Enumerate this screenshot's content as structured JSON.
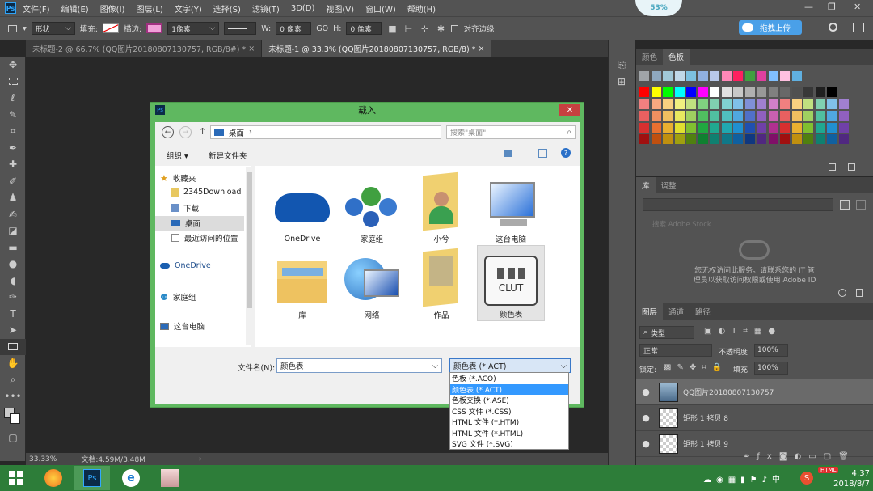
{
  "menubar": {
    "items": [
      "文件(F)",
      "编辑(E)",
      "图像(I)",
      "图层(L)",
      "文字(Y)",
      "选择(S)",
      "滤镜(T)",
      "3D(D)",
      "视图(V)",
      "窗口(W)",
      "帮助(H)"
    ],
    "badge": "53%",
    "window_controls": [
      "—",
      "❐",
      "✕"
    ]
  },
  "options": {
    "shape": "形状",
    "fill_label": "填充:",
    "stroke_label": "描边:",
    "stroke_width": "1像素",
    "w_label": "W:",
    "w_value": "0 像素",
    "link": "GO",
    "h_label": "H:",
    "h_value": "0 像素",
    "align_edges": "对齐边缘",
    "upload_button": "拖拽上传"
  },
  "tabs": [
    {
      "label": "未标题-2 @ 66.7% (QQ图片20180807130757, RGB/8#) *",
      "close": "×"
    },
    {
      "label": "未标题-1 @ 33.3% (QQ图片20180807130757, RGB/8) *",
      "close": "×"
    }
  ],
  "status": {
    "zoom": "33.33%",
    "doc": "文档:4.59M/3.48M",
    "arrow": "›"
  },
  "color_panel": {
    "tabs": [
      "颜色",
      "色板"
    ]
  },
  "library_panel": {
    "tabs": [
      "库",
      "调整"
    ],
    "search_placeholder": "搜索 Adobe Stock",
    "message_line1": "您无权访问此服务。请联系您的 IT 管",
    "message_line2": "理员以获取访问权限或使用 Adobe ID"
  },
  "layers_panel": {
    "tabs": [
      "图层",
      "通道",
      "路径"
    ],
    "filter": "类型",
    "blend_mode": "正常",
    "opacity_label": "不透明度:",
    "opacity_value": "100%",
    "lock_label": "锁定:",
    "fill_label": "填充:",
    "fill_value": "100%",
    "layers": [
      {
        "name": "QQ图片20180807130757"
      },
      {
        "name": "矩形 1 拷贝 8"
      },
      {
        "name": "矩形 1 拷贝 9"
      }
    ]
  },
  "dialog": {
    "title": "载入",
    "close": "✕",
    "breadcrumb": "桌面",
    "search_placeholder": "搜索\"桌面\"",
    "organize": "组织 ▾",
    "new_folder": "新建文件夹",
    "nav": [
      {
        "label": "收藏夹"
      },
      {
        "label": "2345Download"
      },
      {
        "label": "下载"
      },
      {
        "label": "桌面"
      },
      {
        "label": "最近访问的位置"
      },
      {
        "label": "OneDrive"
      },
      {
        "label": "家庭组"
      },
      {
        "label": "这台电脑"
      }
    ],
    "files": [
      {
        "label": "OneDrive"
      },
      {
        "label": "家庭组"
      },
      {
        "label": "小兮"
      },
      {
        "label": "这台电脑"
      },
      {
        "label": "库"
      },
      {
        "label": "网络"
      },
      {
        "label": "作品"
      },
      {
        "label": "颜色表"
      }
    ],
    "clut_text": "CLUT",
    "filename_label": "文件名(N):",
    "filename_value": "颜色表",
    "filetype_value": "颜色表 (*.ACT)",
    "filetype_options": [
      "色板 (*.ACO)",
      "颜色表 (*.ACT)",
      "色板交换 (*.ASE)",
      "CSS 文件 (*.CSS)",
      "HTML 文件 (*.HTM)",
      "HTML 文件 (*.HTML)",
      "SVG 文件 (*.SVG)"
    ]
  },
  "taskbar": {
    "html_badge": "HTML",
    "time": "4:37",
    "date": "2018/8/7",
    "ime": "S"
  },
  "swatch_colors": {
    "row0": [
      "#a0a4a8",
      "#8ea8c0",
      "#a0c8d8",
      "#c0d8e8",
      "#7cc0e0",
      "#90b0e0",
      "#b8c8e8",
      "#ff88b8",
      "#ff2060",
      "#40a040",
      "#e040a0",
      "#80c0ff",
      "#ffc0e0",
      "#60b0e0"
    ],
    "basic": [
      "#ff0000",
      "#ffff00",
      "#00ff00",
      "#00ffff",
      "#0000ff",
      "#ff00ff",
      "#ffffff",
      "#e0e0e0",
      "#c8c8c8",
      "#b0b0b0",
      "#989898",
      "#808080",
      "#686868",
      "#505050",
      "#383838",
      "#202020",
      "#000000"
    ],
    "palette": [
      "#f08080",
      "#f8a880",
      "#f8d080",
      "#f0f080",
      "#c0e080",
      "#80d080",
      "#80d0b0",
      "#80d0d0",
      "#80c0e8",
      "#8090d8",
      "#a080d0",
      "#d080c8",
      "#e86060",
      "#f09060",
      "#f0c060",
      "#e8e860",
      "#a0d060",
      "#50c060",
      "#50c0a0",
      "#50c0c0",
      "#50a8e0",
      "#5070c8",
      "#9060c0",
      "#c860b0",
      "#d83030",
      "#e87030",
      "#e8b030",
      "#e0e030",
      "#80c030",
      "#20a840",
      "#20a890",
      "#20a8b0",
      "#2090d0",
      "#2050b0",
      "#7040a8",
      "#b03090",
      "#a01010",
      "#c05010",
      "#c09010",
      "#a0a010",
      "#508010",
      "#108030",
      "#108070",
      "#107888",
      "#1060a0",
      "#103880",
      "#502880",
      "#801068"
    ]
  }
}
